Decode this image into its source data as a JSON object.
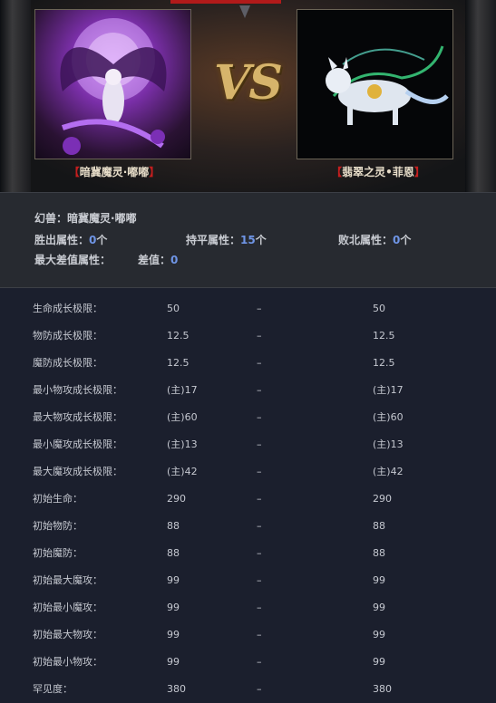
{
  "left_pet": {
    "name": "暗冀魔灵·嘟嘟"
  },
  "right_pet": {
    "name": "翡翠之灵•菲恩"
  },
  "vs_text": "VS",
  "bracket_open": "【",
  "bracket_close": "】",
  "summary": {
    "pet_label": "幻兽：",
    "pet_name": "暗冀魔灵·嘟嘟",
    "win_label": "胜出属性：",
    "win_count": "0",
    "tie_label": "持平属性：",
    "tie_count": "15",
    "lose_label": "败北属性：",
    "lose_count": "0",
    "unit": "个",
    "max_diff_label": "最大差值属性：",
    "diff_label": "差值：",
    "diff_value": "0"
  },
  "rows": [
    {
      "label": "生命成长极限：",
      "left": "50",
      "mid": "–",
      "right": "50"
    },
    {
      "label": "物防成长极限：",
      "left": "12.5",
      "mid": "–",
      "right": "12.5"
    },
    {
      "label": "魔防成长极限：",
      "left": "12.5",
      "mid": "–",
      "right": "12.5"
    },
    {
      "label": "最小物攻成长极限：",
      "left": "(主)17",
      "mid": "–",
      "right": "(主)17"
    },
    {
      "label": "最大物攻成长极限：",
      "left": "(主)60",
      "mid": "–",
      "right": "(主)60"
    },
    {
      "label": "最小魔攻成长极限：",
      "left": "(主)13",
      "mid": "–",
      "right": "(主)13"
    },
    {
      "label": "最大魔攻成长极限：",
      "left": "(主)42",
      "mid": "–",
      "right": "(主)42"
    },
    {
      "label": "初始生命：",
      "left": "290",
      "mid": "–",
      "right": "290"
    },
    {
      "label": "初始物防：",
      "left": "88",
      "mid": "–",
      "right": "88"
    },
    {
      "label": "初始魔防：",
      "left": "88",
      "mid": "–",
      "right": "88"
    },
    {
      "label": "初始最大魔攻：",
      "left": "99",
      "mid": "–",
      "right": "99"
    },
    {
      "label": "初始最小魔攻：",
      "left": "99",
      "mid": "–",
      "right": "99"
    },
    {
      "label": "初始最大物攻：",
      "left": "99",
      "mid": "–",
      "right": "99"
    },
    {
      "label": "初始最小物攻：",
      "left": "99",
      "mid": "–",
      "right": "99"
    },
    {
      "label": "罕见度：",
      "left": "380",
      "mid": "–",
      "right": "380"
    }
  ],
  "colors": {
    "accent_blue": "#6f95e6",
    "bracket_red": "#c41e1e",
    "vs_gold": "#d6b46b"
  }
}
